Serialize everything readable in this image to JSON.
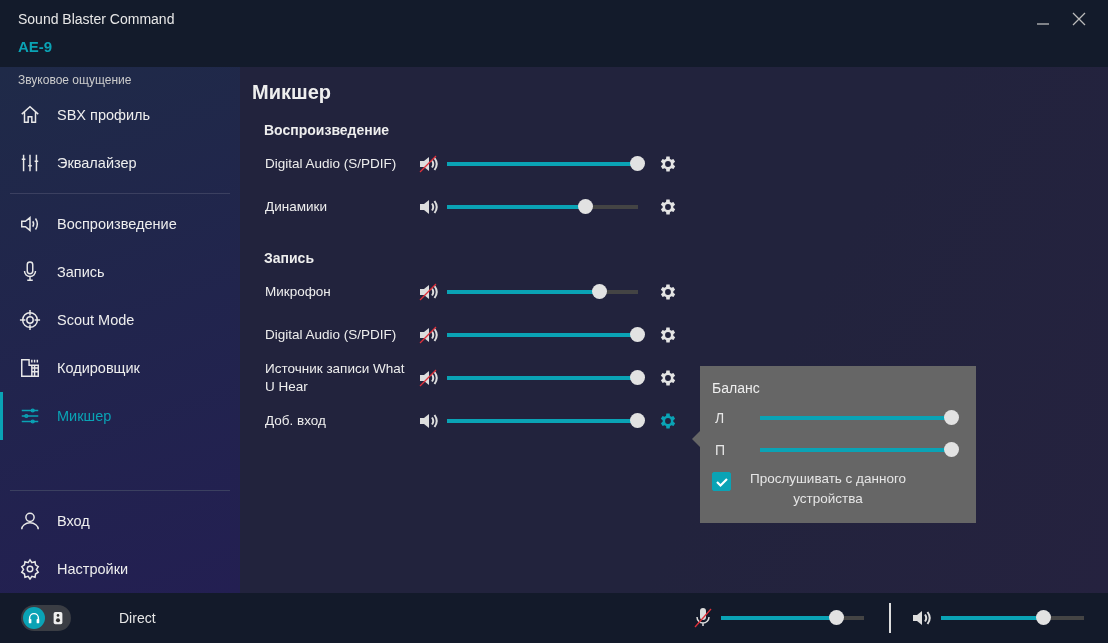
{
  "window": {
    "title": "Sound Blaster Command",
    "device": "AE-9"
  },
  "sidebar": {
    "section_label": "Звуковое ощущение",
    "groups": [
      [
        {
          "label": "SBX профиль",
          "selected": false
        },
        {
          "label": "Эквалайзер",
          "selected": false
        }
      ],
      [
        {
          "label": "Воспроизведение",
          "selected": false
        },
        {
          "label": "Запись",
          "selected": false
        },
        {
          "label": "Scout Mode",
          "selected": false
        },
        {
          "label": "Кодировщик",
          "selected": false
        },
        {
          "label": "Микшер",
          "selected": true
        }
      ],
      [
        {
          "label": "Вход",
          "selected": false
        },
        {
          "label": "Настройки",
          "selected": false
        }
      ]
    ]
  },
  "page_title": "Микшер",
  "sections": [
    {
      "title": "Воспроизведение",
      "channels": [
        {
          "name": "Digital Audio (S/PDIF)",
          "muted": true,
          "level": 1,
          "settings_open": false
        },
        {
          "name": "Динамики",
          "muted": false,
          "level": 0.73,
          "settings_open": false
        }
      ]
    },
    {
      "title": "Запись",
      "channels": [
        {
          "name": "Микрофон",
          "muted": true,
          "level": 0.8,
          "settings_open": false
        },
        {
          "name": "Digital Audio (S/PDIF)",
          "muted": true,
          "level": 1,
          "settings_open": false
        },
        {
          "name": "Источник записи What U Hear",
          "muted": true,
          "level": 1,
          "settings_open": false
        },
        {
          "name": "Доб. вход",
          "muted": false,
          "level": 1,
          "settings_open": true
        }
      ]
    }
  ],
  "popup": {
    "title": "Баланс",
    "balance": [
      {
        "label": "Л",
        "level": 1
      },
      {
        "label": "П",
        "level": 1
      }
    ],
    "monitor": {
      "label": "Прослушивать с данного устройства",
      "checked": true
    }
  },
  "status_bar": {
    "output_toggle": [
      {
        "selected": true
      },
      {
        "selected": false
      }
    ],
    "mode": "Direct",
    "mic": {
      "muted": true,
      "level": 0.81
    },
    "speaker": {
      "muted": false,
      "level": 0.72
    }
  }
}
